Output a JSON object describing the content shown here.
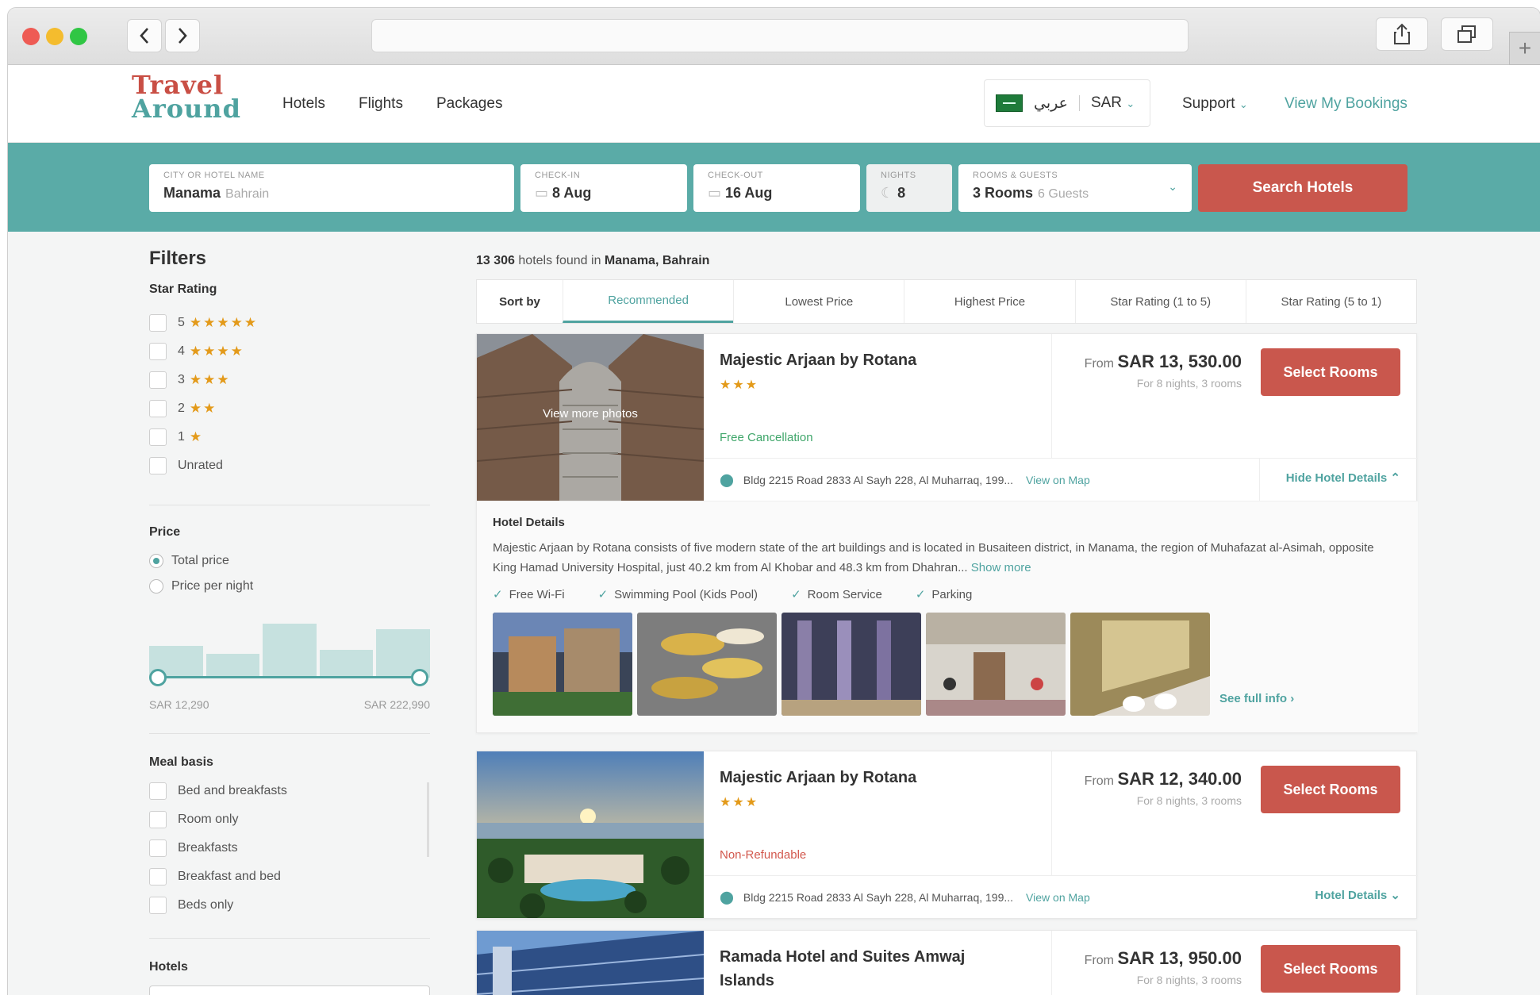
{
  "browser": {
    "url": ""
  },
  "brand": {
    "line1": "Travel",
    "line2": "Around"
  },
  "nav": {
    "hotels": "Hotels",
    "flights": "Flights",
    "packages": "Packages"
  },
  "locale": {
    "language": "عربي",
    "currency": "SAR"
  },
  "header": {
    "support": "Support",
    "bookings": "View My Bookings"
  },
  "search": {
    "city_label": "CITY OR HOTEL NAME",
    "city_value": "Manama",
    "city_hint": "Bahrain",
    "checkin_label": "CHECK-IN",
    "checkin_value": "8 Aug",
    "checkout_label": "CHECK-OUT",
    "checkout_value": "16 Aug",
    "nights_label": "NIGHTS",
    "nights_value": "8",
    "rooms_label": "ROOMS & GUESTS",
    "rooms_value": "3 Rooms",
    "guests_value": "6 Guests",
    "button": "Search Hotels"
  },
  "filters": {
    "title": "Filters",
    "star_title": "Star Rating",
    "star_options": [
      {
        "num": "5",
        "stars": "★★★★★"
      },
      {
        "num": "4",
        "stars": "★★★★"
      },
      {
        "num": "3",
        "stars": "★★★"
      },
      {
        "num": "2",
        "stars": "★★"
      },
      {
        "num": "1",
        "stars": "★"
      }
    ],
    "unrated": "Unrated",
    "price_title": "Price",
    "price_total": "Total price",
    "price_night": "Price per night",
    "price_min": "SAR 12,290",
    "price_max": "SAR 222,990",
    "histogram": [
      0.55,
      0.42,
      0.95,
      0.48,
      0.85
    ],
    "meal_title": "Meal basis",
    "meal_options": [
      "Bed and breakfasts",
      "Room only",
      "Breakfasts",
      "Breakfast and bed",
      "Beds only"
    ],
    "hotels_title": "Hotels"
  },
  "results": {
    "count": "13 306",
    "found_text": "hotels found in",
    "location": "Manama, Bahrain",
    "sort_label": "Sort by",
    "sort_tabs": [
      "Recommended",
      "Lowest Price",
      "Highest Price",
      "Star Rating (1 to 5)",
      "Star Rating (5 to 1)"
    ],
    "hotels": [
      {
        "name": "Majestic Arjaan by Rotana",
        "stars": "★★★",
        "cancellation": "Free Cancellation",
        "from": "From",
        "price": "SAR 13, 530.00",
        "note": "For 8 nights, 3 rooms",
        "select": "Select Rooms",
        "address": "Bldg 2215 Road 2833 Al Sayh 228, Al Muharraq, 199...",
        "map": "View on Map",
        "details_link": "Hide Hotel Details",
        "overlay": "View more photos"
      },
      {
        "name": "Majestic Arjaan by Rotana",
        "stars": "★★★",
        "cancellation": "Non-Refundable",
        "from": "From",
        "price": "SAR 12, 340.00",
        "note": "For 8 nights, 3 rooms",
        "select": "Select Rooms",
        "address": "Bldg 2215 Road 2833 Al Sayh 228, Al Muharraq, 199...",
        "map": "View on Map",
        "details_link": "Hotel Details"
      },
      {
        "name": "Ramada Hotel and Suites Amwaj Islands",
        "stars": "★★★★★",
        "from": "From",
        "price": "SAR 13, 950.00",
        "note": "For 8 nights, 3 rooms",
        "select": "Select Rooms"
      }
    ],
    "details": {
      "title": "Hotel Details",
      "description": "Majestic Arjaan by Rotana consists of five modern state of the art buildings and is located in Busaiteen district, in Manama, the region of Muhafazat al-Asimah, opposite King Hamad University Hospital, just 40.2 km from Al Khobar and 48.3 km from Dhahran...",
      "show_more": "Show more",
      "amenities": [
        "Free Wi-Fi",
        "Swimming Pool (Kids Pool)",
        "Room Service",
        "Parking"
      ],
      "full_info": "See full info"
    }
  },
  "colors": {
    "teal": "#5aaba7",
    "accent": "#4fa3a0",
    "red": "#c9574d",
    "star": "#e39a1a"
  }
}
